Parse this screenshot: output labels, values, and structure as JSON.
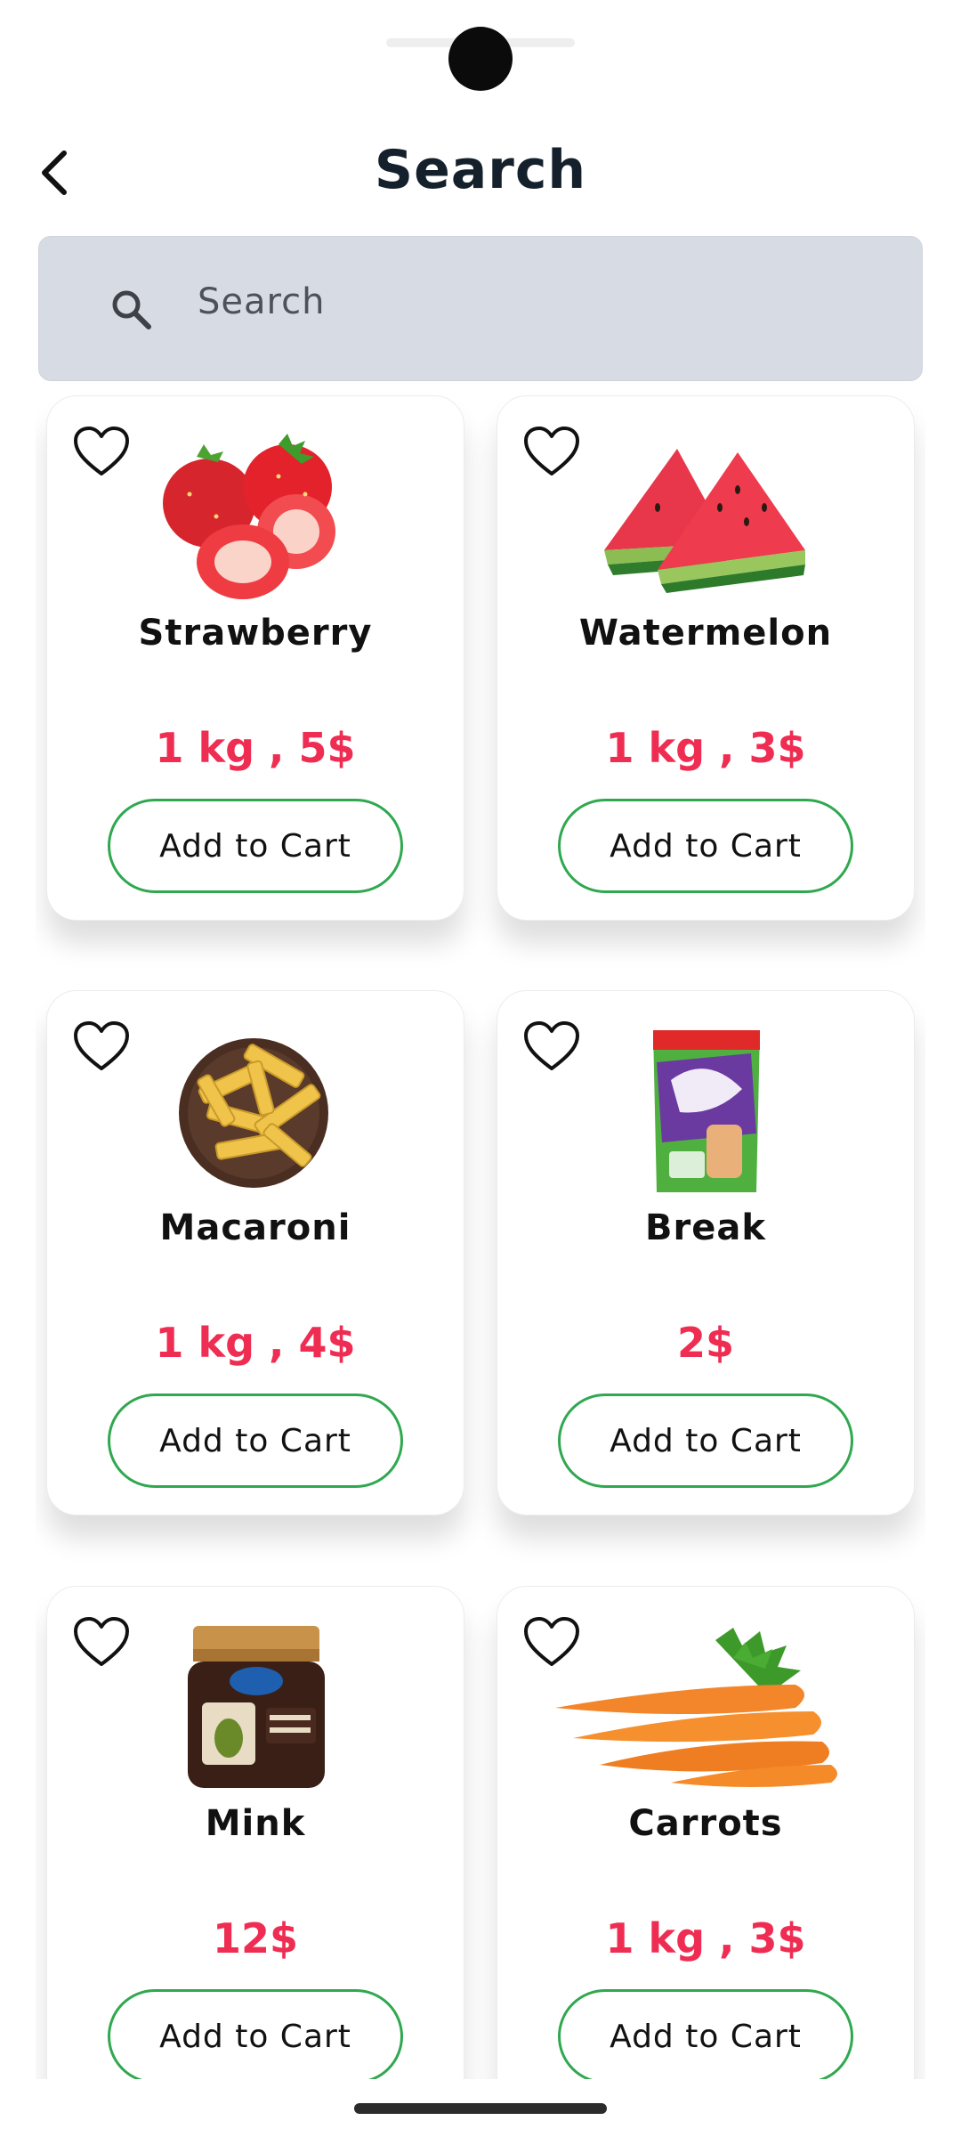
{
  "header": {
    "title": "Search",
    "back_icon": "chevron-left-icon"
  },
  "search": {
    "placeholder": "Search",
    "icon": "search-icon"
  },
  "colors": {
    "price": "#ef2d52",
    "cart_button_border": "#2fa84f",
    "search_bg": "#d7dbe3"
  },
  "products": [
    {
      "name": "Strawberry",
      "price": "1 kg ,  5$",
      "button": "Add to Cart",
      "image": "strawberry-image"
    },
    {
      "name": "Watermelon",
      "price": "1 kg ,  3$",
      "button": "Add to Cart",
      "image": "watermelon-image"
    },
    {
      "name": "Macaroni",
      "price": "1 kg ,  4$",
      "button": "Add to Cart",
      "image": "macaroni-image"
    },
    {
      "name": "Break",
      "price": "2$",
      "button": "Add to Cart",
      "image": "break-snack-image"
    },
    {
      "name": "Mink",
      "price": "12$",
      "button": "Add to Cart",
      "image": "mink-hair-cream-image"
    },
    {
      "name": "Carrots",
      "price": "1 kg ,  3$",
      "button": "Add to Cart",
      "image": "carrots-image"
    }
  ]
}
